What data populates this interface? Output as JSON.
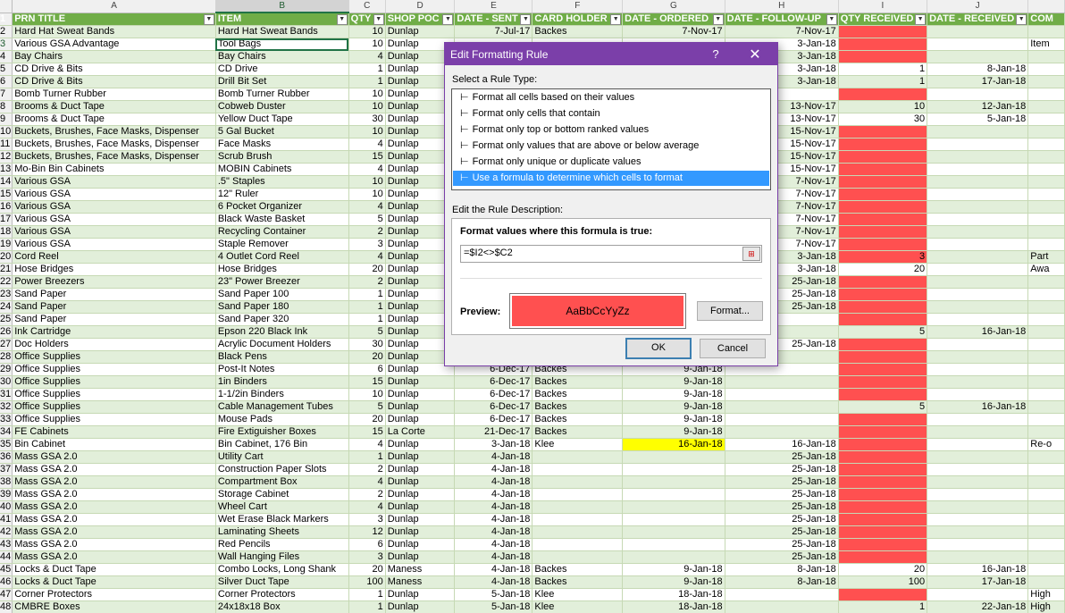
{
  "columns": [
    "A",
    "B",
    "C",
    "D",
    "E",
    "F",
    "G",
    "H",
    "I",
    "J",
    ""
  ],
  "headers": [
    "PRN TITLE",
    "ITEM",
    "QTY",
    "SHOP POC",
    "DATE - SENT",
    "CARD HOLDER",
    "DATE - ORDERED",
    "DATE - FOLLOW-UP",
    "QTY RECEIVED",
    "DATE - RECEIVED",
    "COM"
  ],
  "rows": [
    {
      "rn": "2",
      "c": [
        "Hard Hat Sweat Bands",
        "Hard Hat Sweat Bands",
        "10",
        "Dunlap",
        "7-Jul-17",
        "Backes",
        "7-Nov-17",
        "7-Nov-17",
        "",
        "",
        ""
      ],
      "red": true
    },
    {
      "rn": "3",
      "c": [
        "Various GSA Advantage",
        "Tool Bags",
        "10",
        "Dunlap",
        "",
        "",
        "",
        "3-Jan-18",
        "",
        "",
        "Item"
      ],
      "red": true
    },
    {
      "rn": "4",
      "c": [
        "Bay Chairs",
        "Bay Chairs",
        "4",
        "Dunlap",
        "",
        "",
        "",
        "3-Jan-18",
        "",
        "",
        ""
      ],
      "red": true
    },
    {
      "rn": "5",
      "c": [
        "CD Drive & Bits",
        "CD Drive",
        "1",
        "Dunlap",
        "",
        "",
        "",
        "3-Jan-18",
        "1",
        "8-Jan-18",
        ""
      ]
    },
    {
      "rn": "6",
      "c": [
        "CD Drive & Bits",
        "Drill Bit Set",
        "1",
        "Dunlap",
        "",
        "",
        "",
        "3-Jan-18",
        "1",
        "17-Jan-18",
        ""
      ]
    },
    {
      "rn": "7",
      "c": [
        "Bomb Turner Rubber",
        "Bomb Turner Rubber",
        "10",
        "Dunlap",
        "",
        "",
        "",
        "",
        "",
        "",
        ""
      ],
      "red": true
    },
    {
      "rn": "8",
      "c": [
        "Brooms & Duct Tape",
        "Cobweb Duster",
        "10",
        "Dunlap",
        "",
        "",
        "",
        "13-Nov-17",
        "10",
        "12-Jan-18",
        ""
      ]
    },
    {
      "rn": "9",
      "c": [
        "Brooms & Duct Tape",
        "Yellow Duct Tape",
        "30",
        "Dunlap",
        "",
        "",
        "",
        "13-Nov-17",
        "30",
        "5-Jan-18",
        ""
      ]
    },
    {
      "rn": "10",
      "c": [
        "Buckets, Brushes, Face Masks, Dispenser",
        "5 Gal Bucket",
        "10",
        "Dunlap",
        "",
        "",
        "",
        "15-Nov-17",
        "",
        "",
        ""
      ],
      "red": true
    },
    {
      "rn": "11",
      "c": [
        "Buckets, Brushes, Face Masks, Dispenser",
        "Face Masks",
        "4",
        "Dunlap",
        "",
        "",
        "",
        "15-Nov-17",
        "",
        "",
        ""
      ],
      "red": true
    },
    {
      "rn": "12",
      "c": [
        "Buckets, Brushes, Face Masks, Dispenser",
        "Scrub Brush",
        "15",
        "Dunlap",
        "",
        "",
        "",
        "15-Nov-17",
        "",
        "",
        ""
      ],
      "red": true
    },
    {
      "rn": "13",
      "c": [
        "Mo-Bin Bin Cabinets",
        "MOBIN Cabinets",
        "4",
        "Dunlap",
        "",
        "",
        "",
        "15-Nov-17",
        "",
        "",
        ""
      ],
      "red": true
    },
    {
      "rn": "14",
      "c": [
        "Various GSA",
        ".5\" Staples",
        "10",
        "Dunlap",
        "",
        "",
        "",
        "7-Nov-17",
        "",
        "",
        ""
      ],
      "red": true
    },
    {
      "rn": "15",
      "c": [
        "Various GSA",
        "12\" Ruler",
        "10",
        "Dunlap",
        "",
        "",
        "",
        "7-Nov-17",
        "",
        "",
        ""
      ],
      "red": true
    },
    {
      "rn": "16",
      "c": [
        "Various GSA",
        "6 Pocket Organizer",
        "4",
        "Dunlap",
        "",
        "",
        "",
        "7-Nov-17",
        "",
        "",
        ""
      ],
      "red": true
    },
    {
      "rn": "17",
      "c": [
        "Various GSA",
        "Black Waste Basket",
        "5",
        "Dunlap",
        "",
        "",
        "",
        "7-Nov-17",
        "",
        "",
        ""
      ],
      "red": true
    },
    {
      "rn": "18",
      "c": [
        "Various GSA",
        "Recycling Container",
        "2",
        "Dunlap",
        "",
        "",
        "",
        "7-Nov-17",
        "",
        "",
        ""
      ],
      "red": true
    },
    {
      "rn": "19",
      "c": [
        "Various GSA",
        "Staple Remover",
        "3",
        "Dunlap",
        "",
        "",
        "",
        "7-Nov-17",
        "",
        "",
        ""
      ],
      "red": true
    },
    {
      "rn": "20",
      "c": [
        "Cord Reel",
        "4 Outlet Cord Reel",
        "4",
        "Dunlap",
        "",
        "",
        "",
        "3-Jan-18",
        "3",
        "",
        "Part"
      ],
      "red": true
    },
    {
      "rn": "21",
      "c": [
        "Hose Bridges",
        "Hose Bridges",
        "20",
        "Dunlap",
        "",
        "",
        "",
        "3-Jan-18",
        "20",
        "",
        "Awa"
      ]
    },
    {
      "rn": "22",
      "c": [
        "Power Breezers",
        "23\" Power Breezer",
        "2",
        "Dunlap",
        "",
        "",
        "",
        "25-Jan-18",
        "",
        "",
        ""
      ],
      "red": true
    },
    {
      "rn": "23",
      "c": [
        "Sand Paper",
        "Sand Paper 100",
        "1",
        "Dunlap",
        "",
        "",
        "",
        "25-Jan-18",
        "",
        "",
        ""
      ],
      "red": true
    },
    {
      "rn": "24",
      "c": [
        "Sand Paper",
        "Sand Paper 180",
        "1",
        "Dunlap",
        "",
        "",
        "",
        "25-Jan-18",
        "",
        "",
        ""
      ],
      "red": true
    },
    {
      "rn": "25",
      "c": [
        "Sand Paper",
        "Sand Paper 320",
        "1",
        "Dunlap",
        "",
        "",
        "",
        "",
        "",
        "",
        ""
      ],
      "red": true
    },
    {
      "rn": "26",
      "c": [
        "Ink Cartridge",
        "Epson 220 Black Ink",
        "5",
        "Dunlap",
        "",
        "",
        "",
        "",
        "5",
        "16-Jan-18",
        ""
      ]
    },
    {
      "rn": "27",
      "c": [
        "Doc Holders",
        "Acrylic Document Holders",
        "30",
        "Dunlap",
        "",
        "",
        "",
        "25-Jan-18",
        "",
        "",
        ""
      ],
      "red": true
    },
    {
      "rn": "28",
      "c": [
        "Office Supplies",
        "Black Pens",
        "20",
        "Dunlap",
        "",
        "",
        "",
        "",
        "",
        "",
        ""
      ],
      "red": true
    },
    {
      "rn": "29",
      "c": [
        "Office Supplies",
        "Post-It Notes",
        "6",
        "Dunlap",
        "6-Dec-17",
        "Backes",
        "9-Jan-18",
        "",
        "",
        "",
        ""
      ],
      "red": true
    },
    {
      "rn": "30",
      "c": [
        "Office Supplies",
        "1in Binders",
        "15",
        "Dunlap",
        "6-Dec-17",
        "Backes",
        "9-Jan-18",
        "",
        "",
        "",
        ""
      ],
      "red": true
    },
    {
      "rn": "31",
      "c": [
        "Office Supplies",
        "1-1/2in Binders",
        "10",
        "Dunlap",
        "6-Dec-17",
        "Backes",
        "9-Jan-18",
        "",
        "",
        "",
        ""
      ],
      "red": true
    },
    {
      "rn": "32",
      "c": [
        "Office Supplies",
        "Cable Management Tubes",
        "5",
        "Dunlap",
        "6-Dec-17",
        "Backes",
        "9-Jan-18",
        "",
        "5",
        "16-Jan-18",
        ""
      ]
    },
    {
      "rn": "33",
      "c": [
        "Office Supplies",
        "Mouse Pads",
        "20",
        "Dunlap",
        "6-Dec-17",
        "Backes",
        "9-Jan-18",
        "",
        "",
        "",
        ""
      ],
      "red": true
    },
    {
      "rn": "34",
      "c": [
        "FE Cabinets",
        "Fire Extiguisher Boxes",
        "15",
        "La Corte",
        "21-Dec-17",
        "Backes",
        "9-Jan-18",
        "",
        "",
        "",
        ""
      ],
      "red": true
    },
    {
      "rn": "35",
      "c": [
        "Bin Cabinet",
        "Bin Cabinet, 176 Bin",
        "4",
        "Dunlap",
        "3-Jan-18",
        "Klee",
        "16-Jan-18",
        "16-Jan-18",
        "",
        "",
        "Re-o"
      ],
      "red": true,
      "yellow": true
    },
    {
      "rn": "36",
      "c": [
        "Mass GSA 2.0",
        "Utility Cart",
        "1",
        "Dunlap",
        "4-Jan-18",
        "",
        "",
        "25-Jan-18",
        "",
        "",
        ""
      ],
      "red": true
    },
    {
      "rn": "37",
      "c": [
        "Mass GSA 2.0",
        "Construction Paper Slots",
        "2",
        "Dunlap",
        "4-Jan-18",
        "",
        "",
        "25-Jan-18",
        "",
        "",
        ""
      ],
      "red": true
    },
    {
      "rn": "38",
      "c": [
        "Mass GSA 2.0",
        "Compartment Box",
        "4",
        "Dunlap",
        "4-Jan-18",
        "",
        "",
        "25-Jan-18",
        "",
        "",
        ""
      ],
      "red": true
    },
    {
      "rn": "39",
      "c": [
        "Mass GSA 2.0",
        "Storage Cabinet",
        "2",
        "Dunlap",
        "4-Jan-18",
        "",
        "",
        "25-Jan-18",
        "",
        "",
        ""
      ],
      "red": true
    },
    {
      "rn": "40",
      "c": [
        "Mass GSA 2.0",
        "Wheel Cart",
        "4",
        "Dunlap",
        "4-Jan-18",
        "",
        "",
        "25-Jan-18",
        "",
        "",
        ""
      ],
      "red": true
    },
    {
      "rn": "41",
      "c": [
        "Mass GSA 2.0",
        "Wet Erase Black Markers",
        "3",
        "Dunlap",
        "4-Jan-18",
        "",
        "",
        "25-Jan-18",
        "",
        "",
        ""
      ],
      "red": true
    },
    {
      "rn": "42",
      "c": [
        "Mass GSA 2.0",
        "Laminating Sheets",
        "12",
        "Dunlap",
        "4-Jan-18",
        "",
        "",
        "25-Jan-18",
        "",
        "",
        ""
      ],
      "red": true
    },
    {
      "rn": "43",
      "c": [
        "Mass GSA 2.0",
        "Red Pencils",
        "6",
        "Dunlap",
        "4-Jan-18",
        "",
        "",
        "25-Jan-18",
        "",
        "",
        ""
      ],
      "red": true
    },
    {
      "rn": "44",
      "c": [
        "Mass GSA 2.0",
        "Wall Hanging Files",
        "3",
        "Dunlap",
        "4-Jan-18",
        "",
        "",
        "25-Jan-18",
        "",
        "",
        ""
      ],
      "red": true
    },
    {
      "rn": "45",
      "c": [
        "Locks & Duct Tape",
        "Combo Locks, Long Shank",
        "20",
        "Maness",
        "4-Jan-18",
        "Backes",
        "9-Jan-18",
        "8-Jan-18",
        "20",
        "16-Jan-18",
        ""
      ]
    },
    {
      "rn": "46",
      "c": [
        "Locks & Duct Tape",
        "Silver Duct Tape",
        "100",
        "Maness",
        "4-Jan-18",
        "Backes",
        "9-Jan-18",
        "8-Jan-18",
        "100",
        "17-Jan-18",
        ""
      ]
    },
    {
      "rn": "47",
      "c": [
        "Corner Protectors",
        "Corner Protectors",
        "1",
        "Dunlap",
        "5-Jan-18",
        "Klee",
        "18-Jan-18",
        "",
        "",
        "",
        "High"
      ],
      "red": true
    },
    {
      "rn": "48",
      "c": [
        "CMBRE Boxes",
        "24x18x18 Box",
        "1",
        "Dunlap",
        "5-Jan-18",
        "Klee",
        "18-Jan-18",
        "",
        "1",
        "22-Jan-18",
        "High"
      ]
    }
  ],
  "dialog": {
    "title": "Edit Formatting Rule",
    "help": "?",
    "close": "✕",
    "select_label": "Select a Rule Type:",
    "rule_types": [
      "Format all cells based on their values",
      "Format only cells that contain",
      "Format only top or bottom ranked values",
      "Format only values that are above or below average",
      "Format only unique or duplicate values",
      "Use a formula to determine which cells to format"
    ],
    "selected_index": 5,
    "edit_label": "Edit the Rule Description:",
    "formula_label": "Format values where this formula is true:",
    "formula_value": "=$I2<>$C2",
    "preview_label": "Preview:",
    "preview_text": "AaBbCcYyZz",
    "format_button": "Format...",
    "ok_button": "OK",
    "cancel_button": "Cancel",
    "rule_marker": "⊢",
    "ref_icon": "⊞"
  },
  "colors": {
    "header_green": "#70ad47",
    "band_green": "#e2efda",
    "highlight_red": "#ff5050",
    "highlight_yellow": "#ffff00",
    "dialog_title": "#7b3fa9",
    "list_selected": "#3399ff"
  }
}
